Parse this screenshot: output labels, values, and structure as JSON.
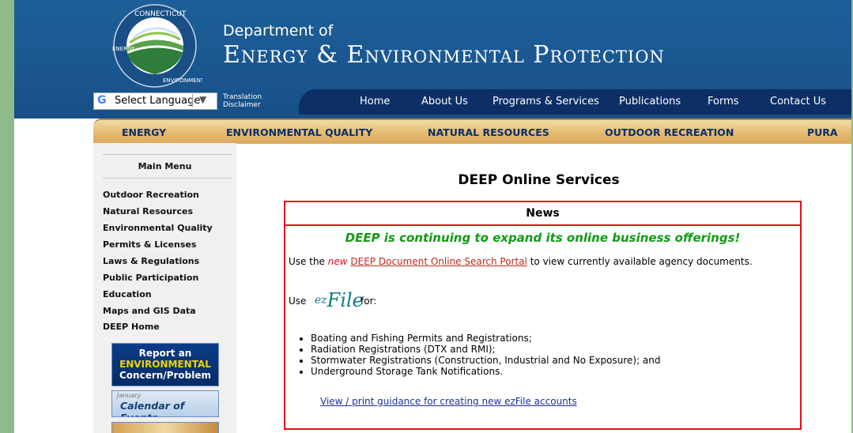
{
  "header": {
    "seal_top": "CONNECTICUT",
    "seal_left": "ENERGY",
    "seal_right": "ENVIRONMENT",
    "dept_line1": "Department of",
    "dept_line2": "Energy & Environmental Protection"
  },
  "language": {
    "g": "G",
    "label": "Select Language",
    "arrow": "▼"
  },
  "translation": {
    "line1": "Translation",
    "line2": "Disclaimer"
  },
  "nav": [
    "Home",
    "About Us",
    "Programs & Services",
    "Publications",
    "Forms",
    "Contact Us"
  ],
  "goldbar": [
    "ENERGY",
    "ENVIRONMENTAL QUALITY",
    "NATURAL RESOURCES",
    "OUTDOOR RECREATION",
    "PURA"
  ],
  "sidebar": {
    "title": "Main Menu",
    "links": [
      "Outdoor Recreation",
      "Natural Resources",
      "Environmental Quality",
      "Permits & Licenses",
      "Laws & Regulations",
      "Public Participation",
      "Education",
      "Maps and GIS Data",
      "DEEP Home"
    ],
    "report_banner": [
      "Report an",
      "ENVIRONMENTAL",
      "Concern/Problem"
    ],
    "calendar_small": "January",
    "calendar_big": "Calendar of Events"
  },
  "main": {
    "title": "DEEP Online Services",
    "news_heading": "News",
    "tagline": "DEEP is continuing to expand its online business offerings!",
    "use_prefix": "Use the",
    "use_new": "new",
    "use_link": "DEEP Document Online Search Portal",
    "use_suffix": "to view currently available agency documents.",
    "use2": "Use",
    "ezfile_ez": "ez",
    "ezfile_file": "File",
    "for": "for:",
    "bullets": [
      "Boating and Fishing Permits and Registrations;",
      "Radiation Registrations (DTX and RMI);",
      "Stormwater Registrations (Construction, Industrial and No Exposure); and",
      "Underground Storage Tank Notifications."
    ],
    "guide_link": "View / print guidance for creating new ezFile accounts"
  }
}
